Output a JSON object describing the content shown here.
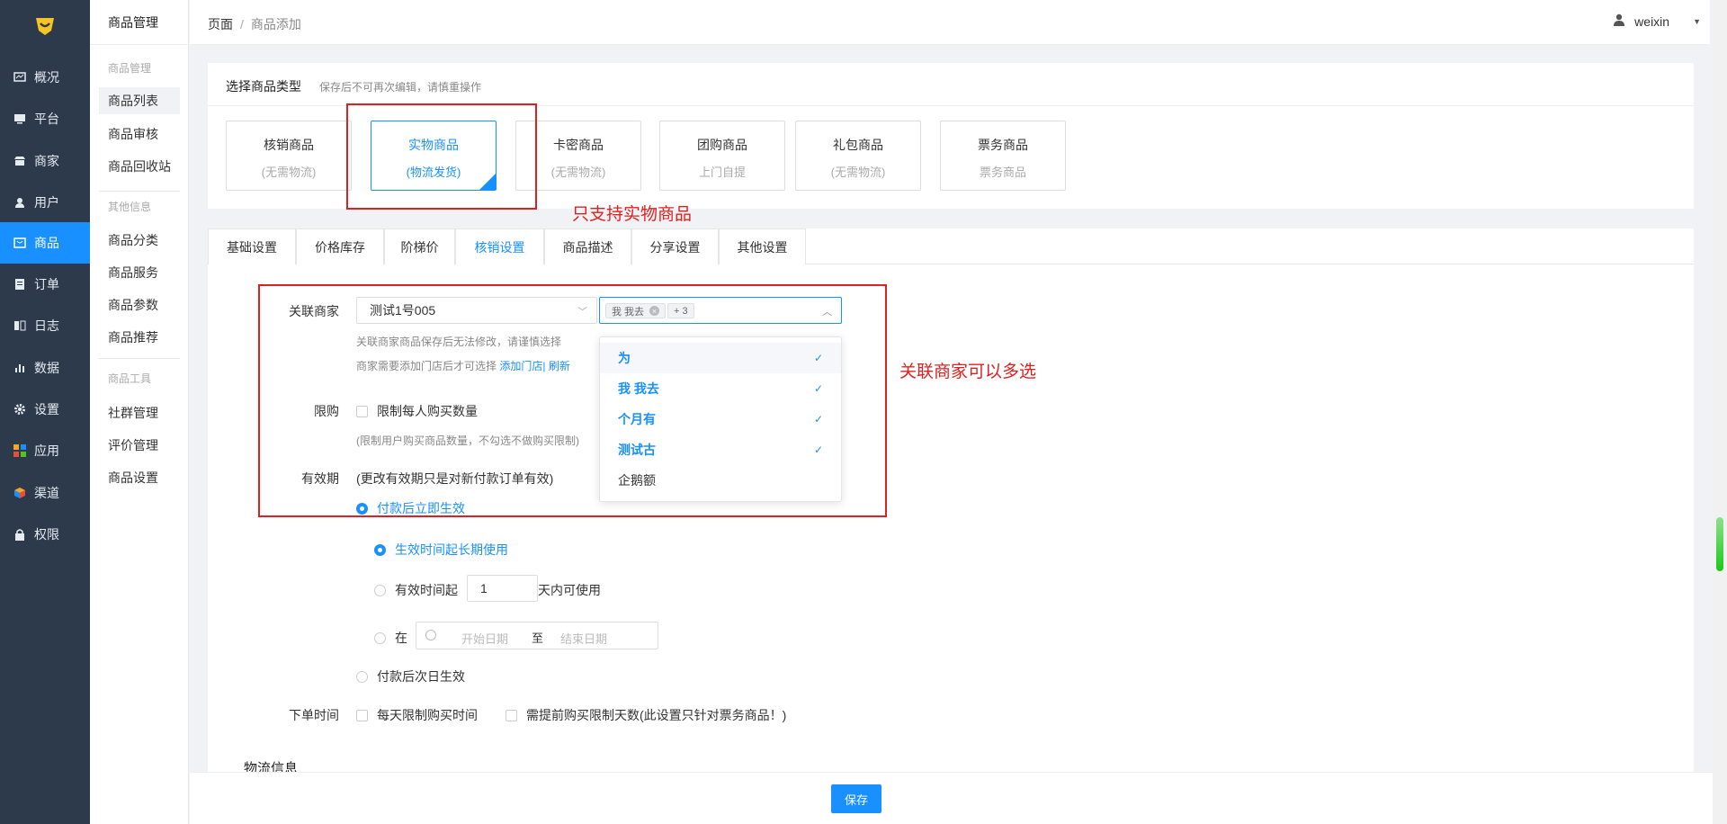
{
  "sidebar": {
    "items": [
      {
        "label": "概况",
        "icon": "dashboard-icon"
      },
      {
        "label": "平台",
        "icon": "monitor-icon"
      },
      {
        "label": "商家",
        "icon": "store-icon"
      },
      {
        "label": "用户",
        "icon": "user-icon"
      },
      {
        "label": "商品",
        "icon": "goods-icon",
        "active": true
      },
      {
        "label": "订单",
        "icon": "order-icon"
      },
      {
        "label": "日志",
        "icon": "log-icon"
      },
      {
        "label": "数据",
        "icon": "chart-icon"
      },
      {
        "label": "设置",
        "icon": "gear-icon"
      },
      {
        "label": "应用",
        "icon": "apps-icon"
      },
      {
        "label": "渠道",
        "icon": "cube-icon"
      },
      {
        "label": "权限",
        "icon": "lock-icon"
      }
    ]
  },
  "subnav": {
    "title": "商品管理",
    "group1": "商品管理",
    "items1": [
      "商品列表",
      "商品审核",
      "商品回收站"
    ],
    "group2": "其他信息",
    "items2": [
      "商品分类",
      "商品服务",
      "商品参数",
      "商品推荐"
    ],
    "group3": "商品工具",
    "items3": [
      "社群管理",
      "评价管理",
      "商品设置"
    ]
  },
  "breadcrumb": {
    "root": "页面",
    "sep": "/",
    "current": "商品添加"
  },
  "user": {
    "name": "weixin"
  },
  "type_section": {
    "title": "选择商品类型",
    "hint": "保存后不可再次编辑，请慎重操作",
    "types": [
      {
        "title": "核销商品",
        "sub": "(无需物流)"
      },
      {
        "title": "实物商品",
        "sub": "(物流发货)",
        "active": true
      },
      {
        "title": "卡密商品",
        "sub": "(无需物流)"
      },
      {
        "title": "团购商品",
        "sub": "上门自提"
      },
      {
        "title": "礼包商品",
        "sub": "(无需物流)"
      },
      {
        "title": "票务商品",
        "sub": "票务商品"
      }
    ]
  },
  "annotations": {
    "only_physical": "只支持实物商品",
    "multi_merchant": "关联商家可以多选"
  },
  "tabs": [
    "基础设置",
    "价格库存",
    "阶梯价",
    "核销设置",
    "商品描述",
    "分享设置",
    "其他设置"
  ],
  "form": {
    "merchant_label": "关联商家",
    "merchant_value": "测试1号005",
    "merchant_tag": "我 我去",
    "merchant_more": "+ 3",
    "hint1": "关联商家商品保存后无法修改，请谨慎选择",
    "hint2_prefix": "商家需要添加门店后才可选择",
    "hint2_link1": "添加门店",
    "hint2_sep": "|",
    "hint2_link2": "刷新",
    "dropdown": [
      {
        "label": "为",
        "selected": true
      },
      {
        "label": "我 我去",
        "selected": true
      },
      {
        "label": "个月有",
        "selected": true
      },
      {
        "label": "测试古",
        "selected": true
      },
      {
        "label": "企鹅额",
        "selected": false
      }
    ],
    "limit_label": "限购",
    "limit_option": "限制每人购买数量",
    "limit_hint": "(限制用户购买商品数量，不勾选不做购买限制)",
    "validity_label": "有效期",
    "validity_note": "(更改有效期只是对新付款订单有效)",
    "valid_opt1": "付款后立即生效",
    "valid_sub1": "生效时间起长期使用",
    "valid_sub2_prefix": "有效时间起",
    "valid_sub2_value": "1",
    "valid_sub2_suffix": "天内可使用",
    "valid_sub3_prefix": "在",
    "start_placeholder": "开始日期",
    "range_sep": "至",
    "end_placeholder": "结束日期",
    "valid_opt2": "付款后次日生效",
    "order_time_label": "下单时间",
    "order_opt1": "每天限制购买时间",
    "order_opt2": "需提前购买限制天数(此设置只针对票务商品！)",
    "logistics_title": "物流信息"
  },
  "footer": {
    "save": "保存"
  }
}
